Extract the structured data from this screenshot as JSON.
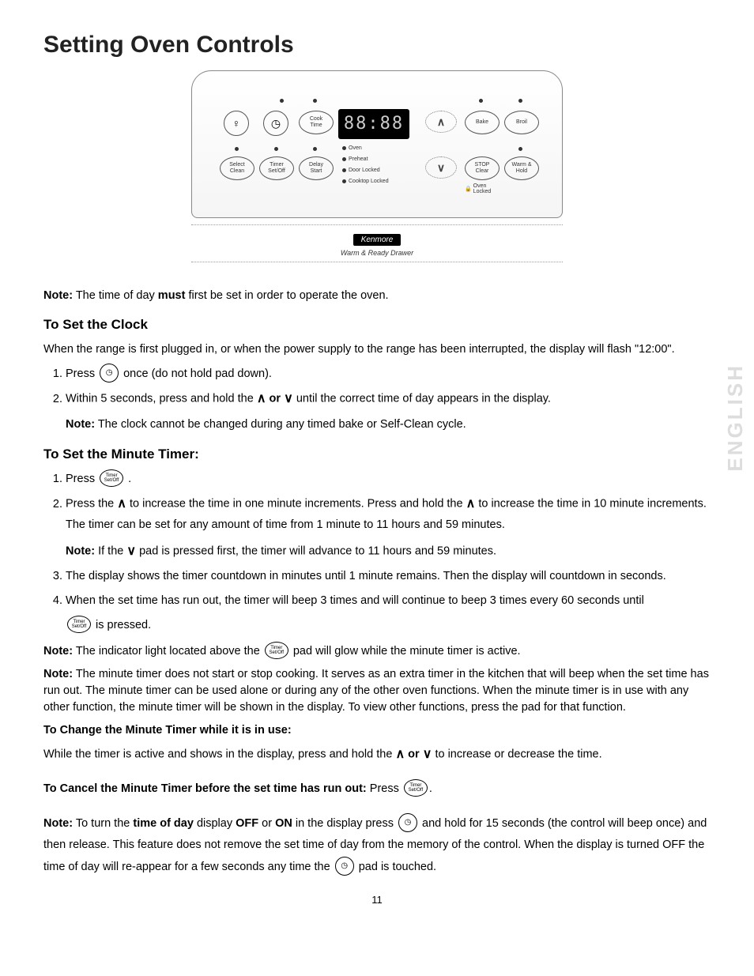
{
  "page": {
    "title": "Setting Oven Controls",
    "number": "11"
  },
  "sidetab": "ENGLISH",
  "panel": {
    "display": "88:88",
    "btn_cooktime": "Cook\nTime",
    "btn_bake": "Bake",
    "btn_broil": "Broil",
    "btn_select_clean": "Select\nClean",
    "btn_timer": "Timer\nSet/Off",
    "btn_delay_start": "Delay\nStart",
    "btn_stop_clear": "STOP\nClear",
    "btn_warm_hold": "Warm &\nHold",
    "ind_oven": "Oven",
    "ind_preheat": "Preheat",
    "ind_door": "Door Locked",
    "ind_cooktop": "Cooktop Locked",
    "ind_ovenlock": "Oven\nLocked",
    "brand": "Kenmore",
    "drawer": "Warm & Ready Drawer"
  },
  "text": {
    "top_note_prefix": "Note:",
    "top_note_a": " The time of day ",
    "top_note_b": "must",
    "top_note_c": " first be set in order to operate the oven.",
    "h_clock": "To Set the Clock",
    "clock_intro": "When the range is first plugged in, or when the power supply to the range has been interrupted, the display will flash \"12:00\".",
    "clock_1a": "Press ",
    "clock_1b": " once (do not hold pad down).",
    "clock_2a": "Within 5 seconds, press and hold the ",
    "clock_2_or": " or ",
    "clock_2b": " until the correct time of day appears in the display.",
    "clock_2_note_prefix": "Note:",
    "clock_2_note": " The clock cannot be changed during any timed bake or Self-Clean cycle.",
    "h_timer": "To Set the Minute Timer:",
    "timer_1a": "Press ",
    "timer_1b": " .",
    "timer_2a": "Press the ",
    "timer_2b": " to increase the time in one minute increments. Press and hold the ",
    "timer_2c": " to increase the time in 10 minute increments. The timer can be set for any amount of time from 1 minute to 11 hours and 59 minutes.",
    "timer_2_note_prefix": "Note:",
    "timer_2_note_a": " If the ",
    "timer_2_note_b": " pad is pressed first, the timer will advance to 11 hours and 59 minutes.",
    "timer_3": "The display shows the timer countdown in minutes until 1 minute remains. Then the display will countdown in seconds.",
    "timer_4a": "When the set time has run out, the timer will beep 3 times and will continue to beep 3 times every 60 seconds until ",
    "timer_4b": " is pressed.",
    "note_ind_prefix": "Note:",
    "note_ind_a": " The indicator light located above the ",
    "note_ind_b": " pad will glow while the minute timer is active.",
    "note_long_prefix": "Note:",
    "note_long": " The minute timer does not start or stop cooking. It serves as an extra timer in the kitchen that will beep when the set time has run out. The minute timer can be used alone or during any of the other oven functions. When the minute timer is in use with any other function, the minute timer will be shown in the display. To view other functions, press the pad for that function.",
    "h_change": "To Change the Minute Timer while it is in use:",
    "change_a": "While the timer is active and shows in the display, press and hold the ",
    "change_or": " or ",
    "change_b": " to increase or decrease the time.",
    "h_cancel_a": "To Cancel the Minute Timer before the set time has run out: ",
    "h_cancel_b": "Press ",
    "h_cancel_c": ".",
    "note_tod_prefix": "Note:",
    "note_tod_a": " To turn the ",
    "note_tod_b": "time of day",
    "note_tod_c": " display ",
    "note_tod_d": "OFF",
    "note_tod_e": " or ",
    "note_tod_f": "ON",
    "note_tod_g": " in the display press ",
    "note_tod_h": " and hold for 15 seconds (the control will beep once) and then release. This feature does not remove the set time of day from the memory of the control. When the display is turned OFF the time of day will re-appear for a few seconds any time the ",
    "note_tod_i": " pad is touched."
  },
  "icons": {
    "clock": "◷",
    "light": "♀",
    "up": "∧",
    "down": "∨",
    "timer_label_top": "Timer",
    "timer_label_bot": "Set/Off",
    "lock": "🔒"
  }
}
